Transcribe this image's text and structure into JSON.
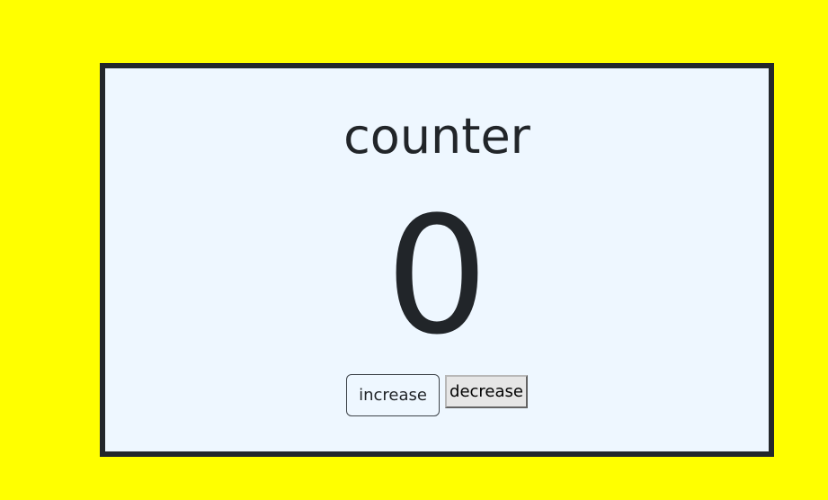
{
  "counter": {
    "title": "counter",
    "value": "0"
  },
  "buttons": {
    "increase_label": "increase",
    "decrease_label": "decrease"
  },
  "colors": {
    "page_background": "#ffff00",
    "card_background": "#eef7ff",
    "card_border": "#23272b",
    "text": "#212529"
  }
}
